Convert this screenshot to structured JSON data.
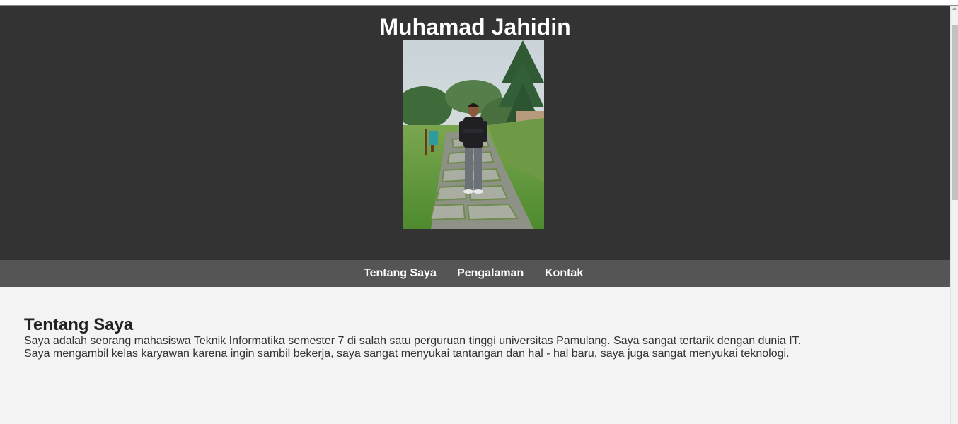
{
  "header": {
    "name": "Muhamad Jahidin",
    "photo_alt": "profile-photo"
  },
  "nav": {
    "items": [
      {
        "label": "Tentang Saya"
      },
      {
        "label": "Pengalaman"
      },
      {
        "label": "Kontak"
      }
    ]
  },
  "about": {
    "title": "Tentang Saya",
    "line1": "Saya adalah seorang mahasiswa Teknik Informatika semester 7 di salah satu perguruan tinggi universitas Pamulang. Saya sangat tertarik dengan dunia IT.",
    "line2": "Saya mengambil kelas karyawan karena ingin sambil bekerja, saya sangat menyukai tantangan dan hal - hal baru, saya juga sangat menyukai teknologi."
  },
  "colors": {
    "header_bg": "#333333",
    "nav_bg": "#555555",
    "body_bg": "#f3f3f3",
    "text_light": "#ffffff"
  }
}
